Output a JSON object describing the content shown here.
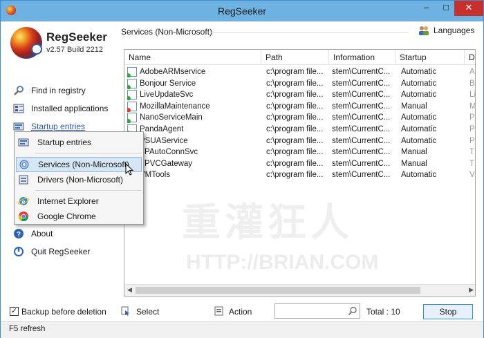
{
  "window": {
    "title": "RegSeeker"
  },
  "app": {
    "name": "RegSeeker",
    "version": "v2.57 Build 2212"
  },
  "sidebar": {
    "items": [
      {
        "label": "Find in registry",
        "icon": "magnifier-icon"
      },
      {
        "label": "Installed applications",
        "icon": "applications-icon"
      },
      {
        "label": "Startup entries",
        "icon": "startup-icon"
      },
      {
        "label": "About",
        "icon": "about-icon"
      },
      {
        "label": "Quit RegSeeker",
        "icon": "quit-icon"
      }
    ]
  },
  "main": {
    "header": "Services (Non-Microsoft)",
    "languages_label": "Languages"
  },
  "table": {
    "columns": [
      "Name",
      "Path",
      "Information",
      "Startup",
      "D"
    ],
    "rows": [
      {
        "name": "AdobeARMservice",
        "path": "c:\\program file...",
        "info": "stem\\CurrentC...",
        "startup": "Automatic",
        "d": "Ad",
        "dot": "#2fa83a"
      },
      {
        "name": "Bonjour Service",
        "path": "c:\\program file...",
        "info": "stem\\CurrentC...",
        "startup": "Automatic",
        "d": "Bo",
        "dot": "#2fa83a"
      },
      {
        "name": "LiveUpdateSvc",
        "path": "c:\\program file...",
        "info": "stem\\CurrentC...",
        "startup": "Automatic",
        "d": "Li",
        "dot": "#2fa83a"
      },
      {
        "name": "MozillaMaintenance",
        "path": "c:\\program file...",
        "info": "stem\\CurrentC...",
        "startup": "Manual",
        "d": "M",
        "dot": "#d9432b"
      },
      {
        "name": "NanoServiceMain",
        "path": "c:\\program file...",
        "info": "stem\\CurrentC...",
        "startup": "Automatic",
        "d": "Pa",
        "dot": "#2fa83a"
      },
      {
        "name": "PandaAgent",
        "path": "c:\\program file...",
        "info": "stem\\CurrentC...",
        "startup": "Automatic",
        "d": "Pa",
        "dot": "#2fa83a"
      },
      {
        "name": "PSUAService",
        "path": "c:\\program file...",
        "info": "stem\\CurrentC...",
        "startup": "Automatic",
        "d": "Pa",
        "dot": "#2fa83a"
      },
      {
        "name": "TPAutoConnSvc",
        "path": "c:\\program file...",
        "info": "stem\\CurrentC...",
        "startup": "Manual",
        "d": "TF",
        "dot": "#d9432b"
      },
      {
        "name": "TPVCGateway",
        "path": "c:\\program file...",
        "info": "stem\\CurrentC...",
        "startup": "Manual",
        "d": "TF",
        "dot": "#d9432b"
      },
      {
        "name": "VMTools",
        "path": "c:\\program file...",
        "info": "stem\\CurrentC...",
        "startup": "Automatic",
        "d": "VI",
        "dot": "#2fa83a"
      }
    ]
  },
  "popup_menu": {
    "items": [
      {
        "label": "Startup entries",
        "icon": "startup-icon"
      },
      {
        "label": "Services (Non-Microsoft)",
        "icon": "services-icon"
      },
      {
        "label": "Drivers (Non-Microsoft)",
        "icon": "drivers-icon"
      },
      {
        "label": "Internet Explorer",
        "icon": "internet-explorer-icon"
      },
      {
        "label": "Google Chrome",
        "icon": "google-chrome-icon"
      }
    ]
  },
  "bottom": {
    "backup_label": "Backup before deletion",
    "select_label": "Select",
    "action_label": "Action",
    "search_value": "",
    "total_label": "Total : 10",
    "stop_label": "Stop"
  },
  "status": {
    "text": "F5 refresh"
  },
  "watermark": {
    "main": "重灌狂人",
    "url": "HTTP://BRIAN.COM"
  }
}
